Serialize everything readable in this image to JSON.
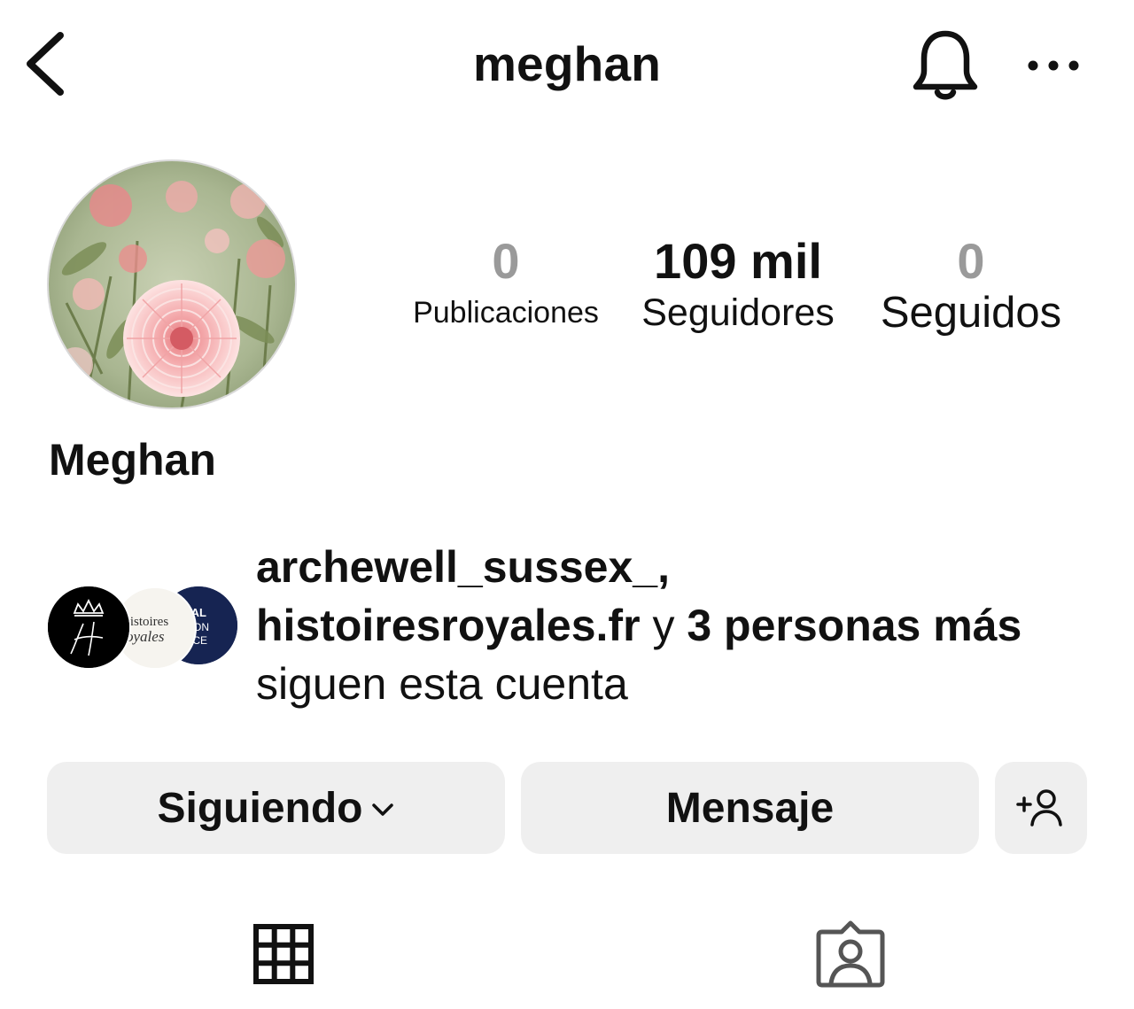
{
  "header": {
    "username": "meghan",
    "back_icon": "chevron-left-icon",
    "bell_icon": "bell-icon",
    "more_icon": "more-horizontal-icon"
  },
  "profile": {
    "display_name": "Meghan",
    "avatar": "flower-profile-photo",
    "stats": {
      "posts": {
        "value": "0",
        "label": "Publicaciones"
      },
      "followers": {
        "value": "109 mil",
        "label": "Seguidores"
      },
      "following": {
        "value": "0",
        "label": "Seguidos"
      }
    }
  },
  "followed_by": {
    "account_1": "archewell_sussex_,",
    "account_2": "histoiresroyales.fr",
    "connector": "y",
    "others": "3 personas más",
    "suffix": "siguen esta cuenta",
    "avatar_labels": {
      "a2_line1": "Histoires",
      "a2_line2": "oyales",
      "a3_line1": "OYAL",
      "a3_line2": "SHION",
      "a3_line3": "OLICE"
    }
  },
  "actions": {
    "following_label": "Siguiendo",
    "message_label": "Mensaje",
    "add_person_icon": "add-person-icon"
  },
  "tabs": {
    "grid_icon": "grid-icon",
    "tagged_icon": "tagged-person-icon"
  },
  "colors": {
    "background": "#ffffff",
    "text": "#111111",
    "muted_number": "#9a9a9a",
    "button_bg": "#efefef"
  }
}
